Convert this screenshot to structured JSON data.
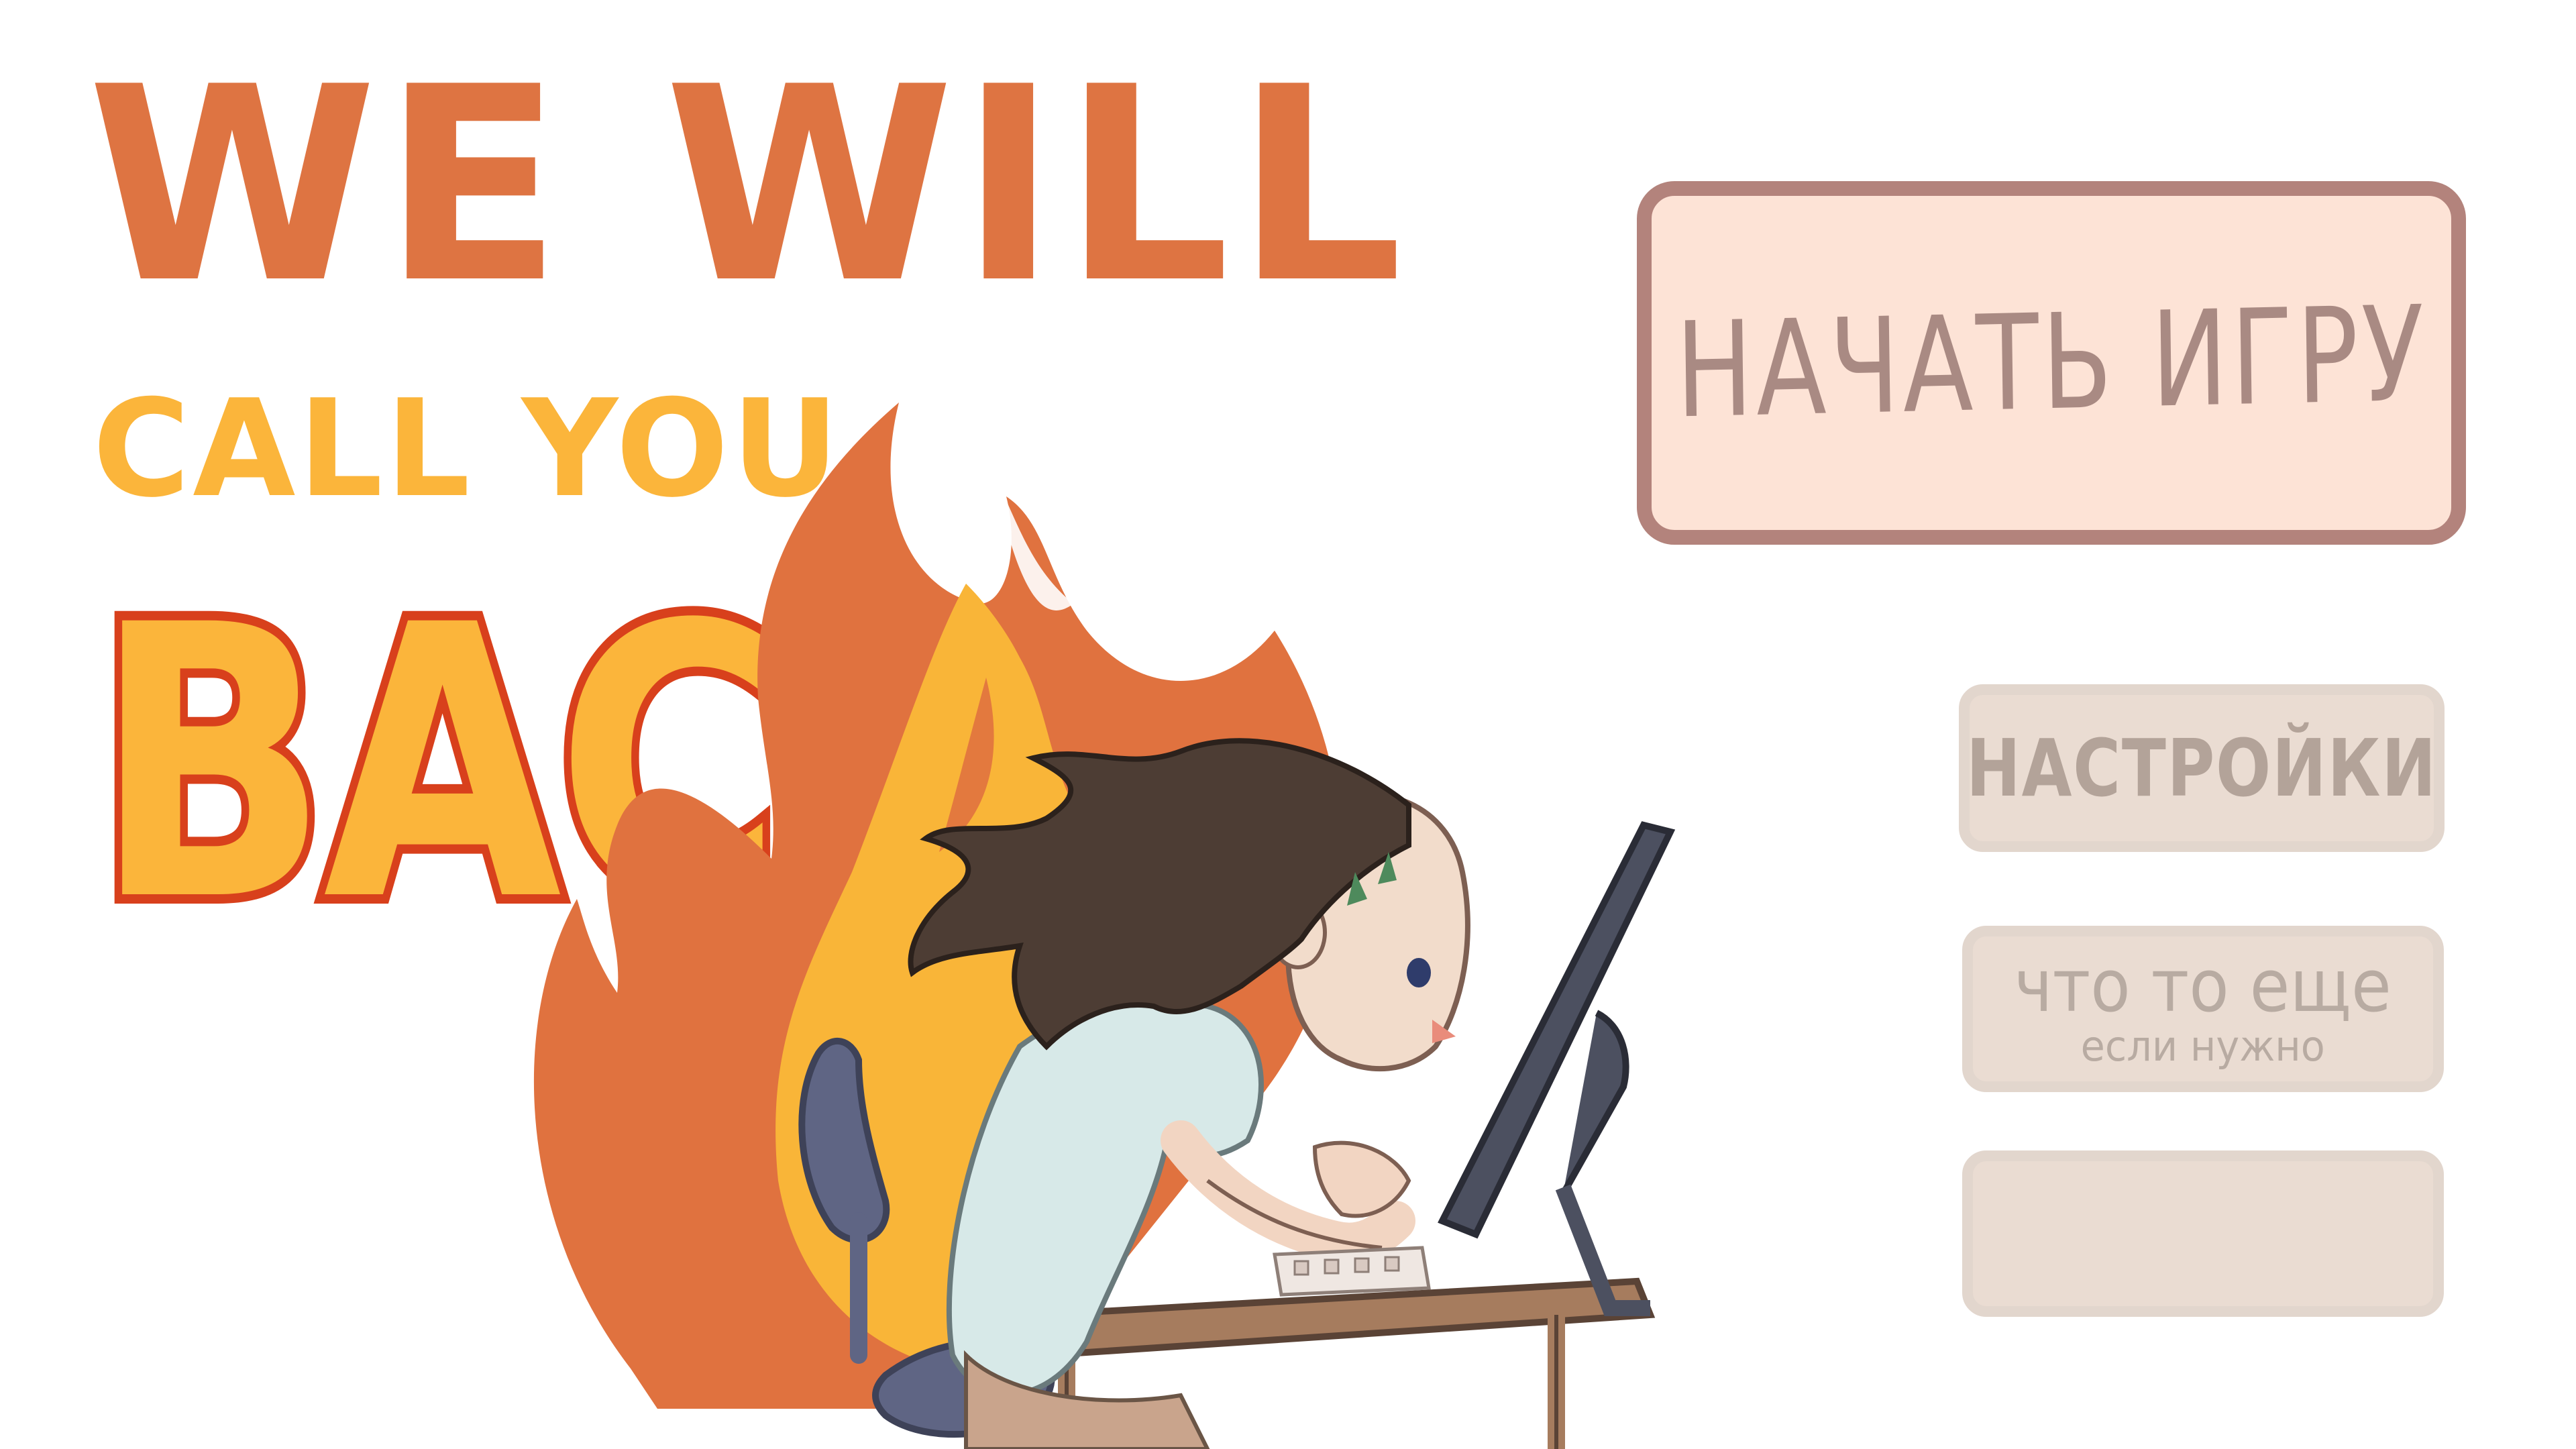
{
  "title": {
    "line1": "WE WILL",
    "line2": "CALL YOU",
    "line3": "BACK"
  },
  "colors": {
    "title_primary": "#de7442",
    "title_secondary": "#fbb53b",
    "title_outline": "#d8401c",
    "flame_outer": "#e0723f",
    "flame_inner": "#f9b538",
    "button_primary_fill": "#fde3d6",
    "button_primary_border": "#b3837c",
    "button_secondary_fill": "#eadcd2"
  },
  "menu": {
    "start_label": "НАЧАТЬ ИГРУ",
    "settings_label": "НАСТРОЙКИ",
    "extra_label": "что то еще",
    "extra_sublabel": "если нужно",
    "blank_label": ""
  },
  "illustration": {
    "subject": "girl-typing-at-computer-in-front-of-flame-icon"
  }
}
